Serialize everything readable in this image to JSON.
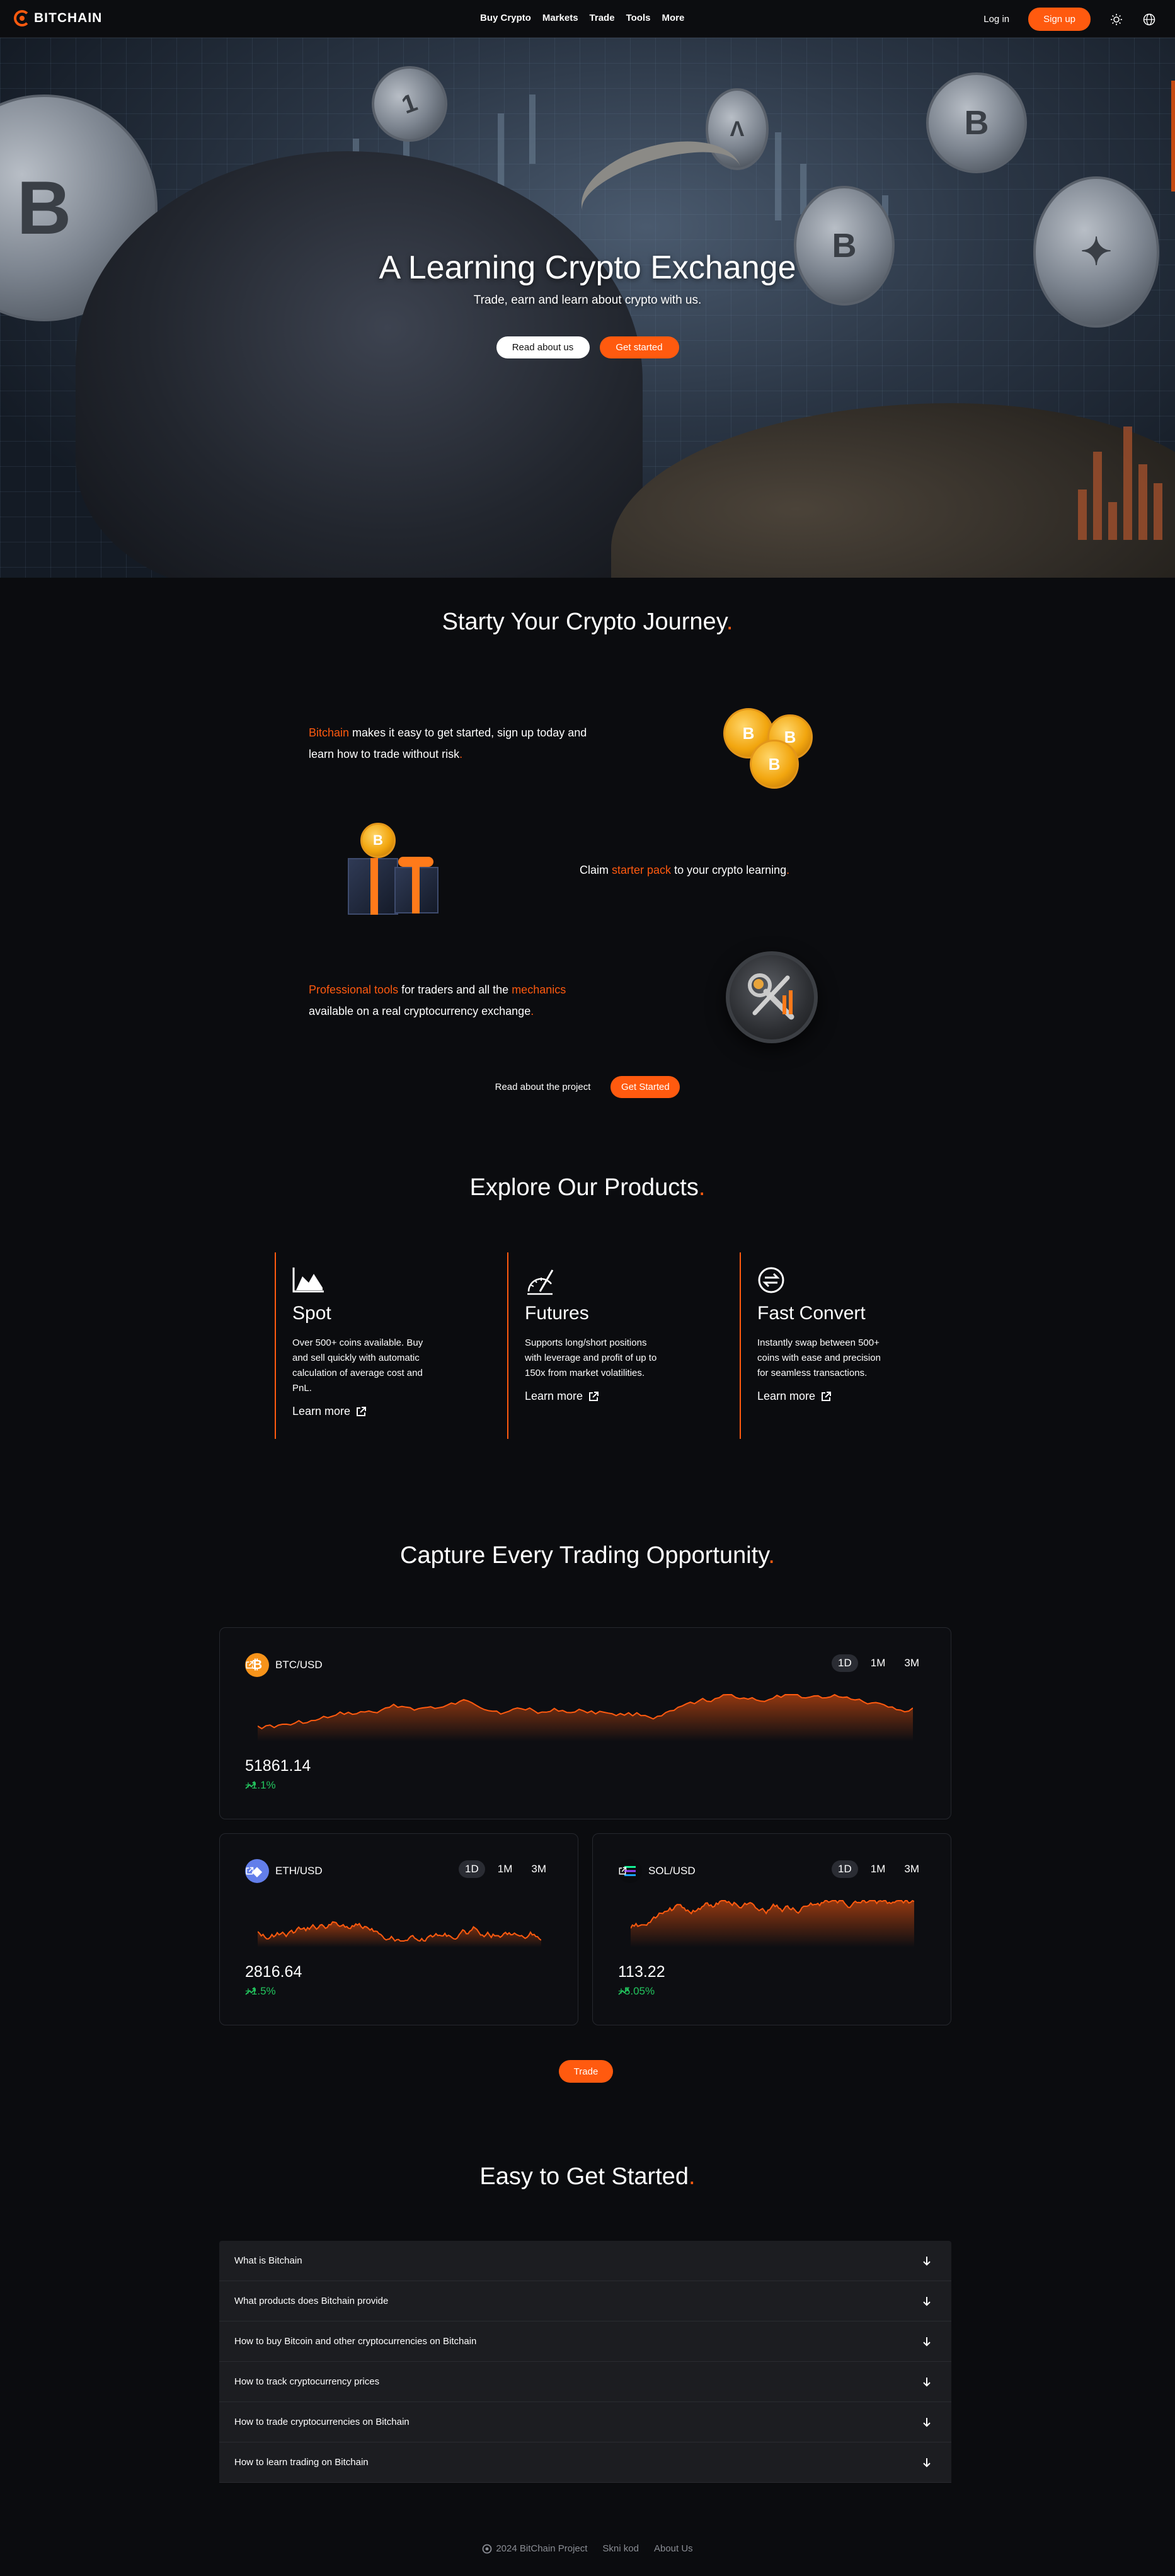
{
  "nav": {
    "brand": "BITCHAIN",
    "links": [
      "Buy Crypto",
      "Markets",
      "Trade",
      "Tools",
      "More"
    ],
    "login": "Log in",
    "signup": "Sign up"
  },
  "hero": {
    "title": "A Learning Crypto Exchange",
    "subtitle": "Trade, earn and learn about crypto with us.",
    "btn_about": "Read about us",
    "btn_start": "Get started"
  },
  "journey": {
    "title": "Starty Your Crypto Journey",
    "dot": ".",
    "block1": {
      "highlight": "Bitchain",
      "rest_line1": " makes it easy to get started, sign up today and",
      "line2": "learn how to trade without risk",
      "end": "."
    },
    "block2": {
      "pre": "Claim ",
      "highlight": "starter pack",
      "post": " to your crypto learning",
      "end": "."
    },
    "block3": {
      "highlight1": "Professional tools",
      "mid": " for traders and all the ",
      "highlight2": "mechanics",
      "line2": "available on a real cryptocurrency exchange",
      "end": "."
    },
    "link_project": "Read about the project",
    "btn_started": "Get Started"
  },
  "products": {
    "title": "Explore Our Products",
    "dot": ".",
    "items": [
      {
        "name": "Spot",
        "icon": "area-chart-icon",
        "desc": "Over 500+ coins available. Buy and sell quickly with automatic calculation of average cost and PnL.",
        "link": "Learn more"
      },
      {
        "name": "Futures",
        "icon": "gauge-icon",
        "desc": "Supports long/short positions with leverage and profit of up to 150x from market volatilities.",
        "link": "Learn more"
      },
      {
        "name": "Fast Convert",
        "icon": "swap-icon",
        "desc": "Instantly swap between 500+ coins with ease and precision for seamless transactions.",
        "link": "Learn more"
      }
    ]
  },
  "capture": {
    "title": "Capture Every Trading Opportunity",
    "dot": ".",
    "ranges": [
      "1D",
      "1M",
      "3M"
    ],
    "cards": [
      {
        "pair": "BTC/USD",
        "icon": "bitcoin-icon",
        "color": "#f7931a",
        "price": "51861.14",
        "change": "+1.1%"
      },
      {
        "pair": "ETH/USD",
        "icon": "ethereum-icon",
        "color": "#627eea",
        "price": "2816.64",
        "change": "+1.5%"
      },
      {
        "pair": "SOL/USD",
        "icon": "solana-icon",
        "color": "#14f195",
        "price": "113.22",
        "change": "+5.05%"
      }
    ],
    "trade": "Trade"
  },
  "faq": {
    "title": "Easy to Get Started",
    "dot": ".",
    "items": [
      "What is Bitchain",
      "What products does Bitchain provide",
      "How to buy Bitcoin and other cryptocurrencies on Bitchain",
      "How to track cryptocurrency prices",
      "How to trade cryptocurrencies on Bitchain",
      "How to learn trading on Bitchain"
    ]
  },
  "footer": {
    "copyright": "2024 BitChain Project",
    "links": [
      "Skni kod",
      "About Us"
    ]
  },
  "colors": {
    "accent": "#ff5a0f",
    "background": "#0b0c0f",
    "positive": "#22c55e"
  }
}
